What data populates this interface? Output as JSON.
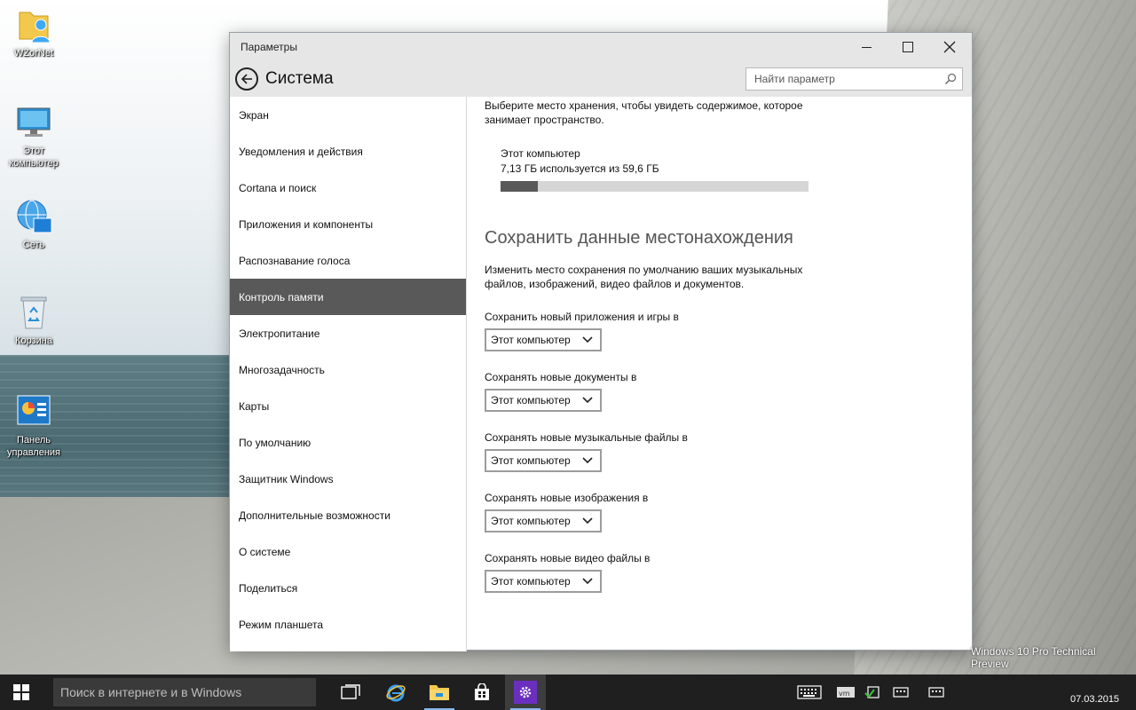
{
  "desktop": {
    "icons": [
      {
        "label": "WZorNet"
      },
      {
        "label": "Этот компьютер"
      },
      {
        "label": "Сеть"
      },
      {
        "label": "Корзина"
      },
      {
        "label": "Панель управления"
      }
    ],
    "watermark": "Windows 10 Pro Technical Preview"
  },
  "window": {
    "title": "Параметры",
    "page_title": "Система",
    "search_placeholder": "Найти параметр"
  },
  "sidebar": {
    "items": [
      {
        "label": "Экран",
        "active": false
      },
      {
        "label": "Уведомления и действия",
        "active": false
      },
      {
        "label": "Cortana и поиск",
        "active": false
      },
      {
        "label": "Приложения и компоненты",
        "active": false
      },
      {
        "label": "Распознавание голоса",
        "active": false
      },
      {
        "label": "Контроль памяти",
        "active": true
      },
      {
        "label": "Электропитание",
        "active": false
      },
      {
        "label": "Многозадачность",
        "active": false
      },
      {
        "label": "Карты",
        "active": false
      },
      {
        "label": "По умолчанию",
        "active": false
      },
      {
        "label": "Защитник Windows",
        "active": false
      },
      {
        "label": "Дополнительные возможности",
        "active": false
      },
      {
        "label": "О системе",
        "active": false
      },
      {
        "label": "Поделиться",
        "active": false
      },
      {
        "label": "Режим планшета",
        "active": false
      }
    ]
  },
  "content": {
    "intro": "Выберите место хранения, чтобы увидеть содержимое, которое занимает пространство.",
    "storage": {
      "name": "Этот компьютер",
      "usage": "7,13 ГБ используется из 59,6 ГБ",
      "used_fraction": 0.12
    },
    "section_title": "Сохранить данные местонахождения",
    "section_desc": "Изменить место сохранения по умолчанию ваших музыкальных файлов, изображений, видео файлов и документов.",
    "fields": [
      {
        "label": "Сохранить новый приложения и игры в",
        "value": "Этот компьютер"
      },
      {
        "label": "Сохранять новые документы в",
        "value": "Этот компьютер"
      },
      {
        "label": "Сохранять новые музыкальные файлы в",
        "value": "Этот компьютер"
      },
      {
        "label": "Сохранять новые изображения в",
        "value": "Этот компьютер"
      },
      {
        "label": "Сохранять новые видео файлы в",
        "value": "Этот компьютер"
      }
    ]
  },
  "taskbar": {
    "search_placeholder": "Поиск в интернете и в Windows",
    "clock_date": "07.03.2015"
  },
  "colors": {
    "accent": "#595959",
    "taskbar": "#1f1f1f",
    "settings_icon_bg": "#6b2fbf"
  }
}
